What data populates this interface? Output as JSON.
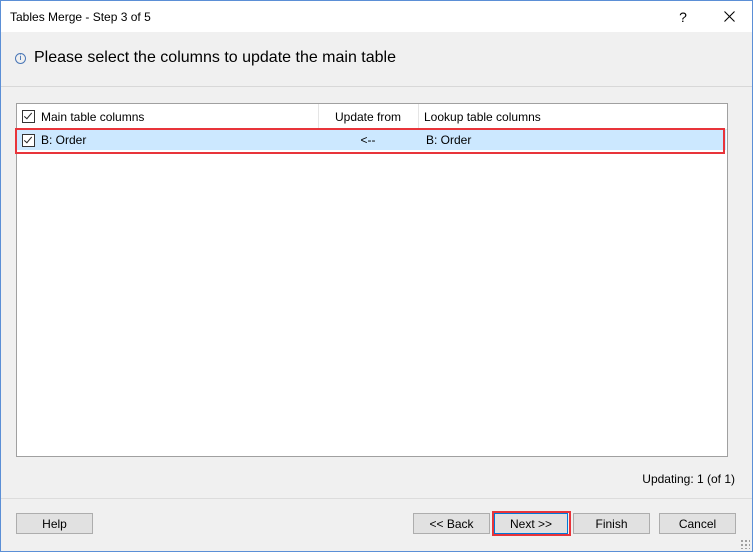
{
  "window": {
    "title": "Tables Merge - Step 3 of 5",
    "help_glyph": "?",
    "close_glyph": "✕"
  },
  "header": {
    "icon": "info-icon",
    "icon_glyph": "i",
    "text": "Please select the columns to update the main table"
  },
  "table": {
    "columns": [
      "Main table columns",
      "Update from",
      "Lookup table columns"
    ],
    "header_checked": true,
    "rows": [
      {
        "checked": true,
        "main": "B: Order",
        "update_from": "<--",
        "lookup": "B: Order",
        "selected": true
      }
    ]
  },
  "status": {
    "text": "Updating: 1 (of 1)"
  },
  "buttons": {
    "help": "Help",
    "back": "<< Back",
    "next": "Next >>",
    "finish": "Finish",
    "cancel": "Cancel"
  },
  "colors": {
    "accent": "#0078d7",
    "selection": "#cce8ff",
    "annotation_red": "#e8343a"
  }
}
